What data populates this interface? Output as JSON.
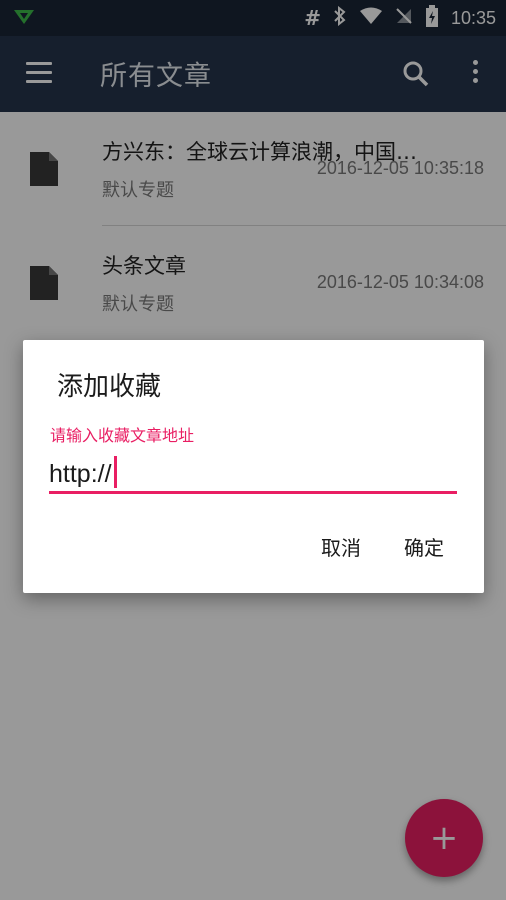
{
  "status_bar": {
    "time": "10:35",
    "icons": [
      "signal-icon",
      "hash-icon",
      "bluetooth-icon",
      "wifi-icon",
      "no-sim-icon",
      "battery-charging-icon"
    ]
  },
  "toolbar": {
    "title": "所有文章",
    "menu_icon": "menu-icon",
    "search_icon": "search-icon",
    "more_icon": "more-vert-icon"
  },
  "articles": [
    {
      "title": "方兴东：全球云计算浪潮，中国…",
      "subtitle": "默认专题",
      "date": "2016-12-05 10:35:18"
    },
    {
      "title": "头条文章",
      "subtitle": "默认专题",
      "date": "2016-12-05 10:34:08"
    }
  ],
  "dialog": {
    "title": "添加收藏",
    "field_label": "请输入收藏文章地址",
    "field_value": "http://",
    "cancel_label": "取消",
    "confirm_label": "确定"
  },
  "fab": {
    "label": "+"
  },
  "colors": {
    "status_bar": "#1a2636",
    "toolbar": "#26354c",
    "accent": "#e91e63"
  }
}
